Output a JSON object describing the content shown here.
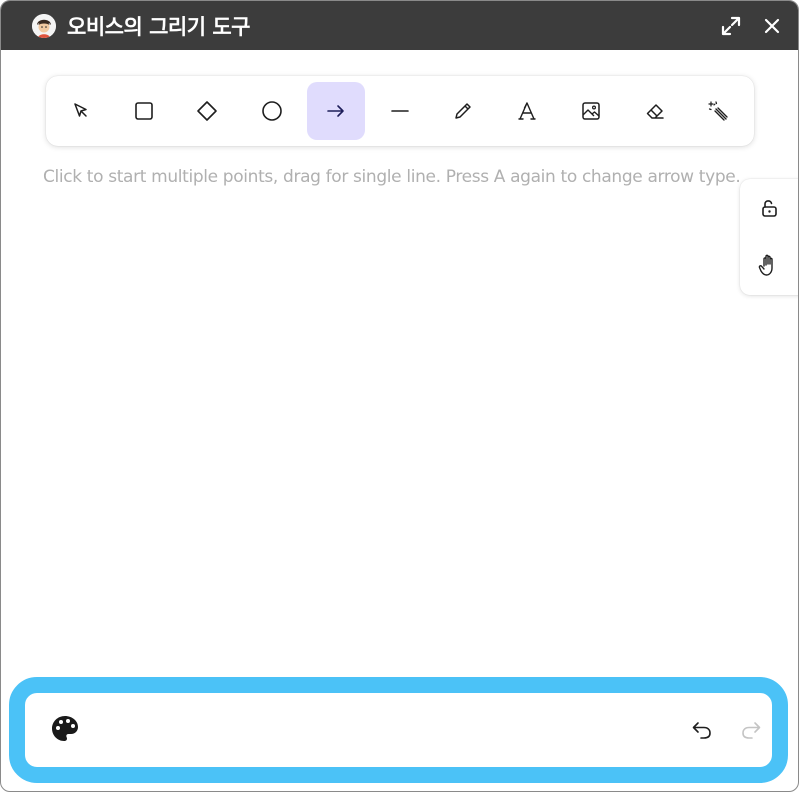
{
  "window": {
    "title": "오비스의 그리기 도구",
    "titlebar_color": "#3c3c3c"
  },
  "toolbar": {
    "tools": [
      {
        "name": "selection",
        "icon": "pointer-icon",
        "active": false
      },
      {
        "name": "rectangle",
        "icon": "rectangle-icon",
        "active": false
      },
      {
        "name": "diamond",
        "icon": "diamond-icon",
        "active": false
      },
      {
        "name": "ellipse",
        "icon": "circle-icon",
        "active": false
      },
      {
        "name": "arrow",
        "icon": "arrow-right-icon",
        "active": true
      },
      {
        "name": "line",
        "icon": "line-icon",
        "active": false
      },
      {
        "name": "draw",
        "icon": "pencil-icon",
        "active": false
      },
      {
        "name": "text",
        "icon": "text-icon",
        "active": false
      },
      {
        "name": "image",
        "icon": "image-icon",
        "active": false
      },
      {
        "name": "eraser",
        "icon": "eraser-icon",
        "active": false
      },
      {
        "name": "magic",
        "icon": "magic-wand-icon",
        "active": false
      }
    ],
    "active_color": "#e0dcfd"
  },
  "canvas": {
    "hint": "Click to start multiple points, drag for single line. Press A again to change arrow type."
  },
  "side_panel": {
    "buttons": [
      "unlock-icon",
      "hand-icon"
    ]
  },
  "bottom_bar": {
    "highlight_color": "#4bc2f7",
    "buttons": [
      "palette-icon",
      "undo-icon",
      "redo-icon"
    ]
  }
}
